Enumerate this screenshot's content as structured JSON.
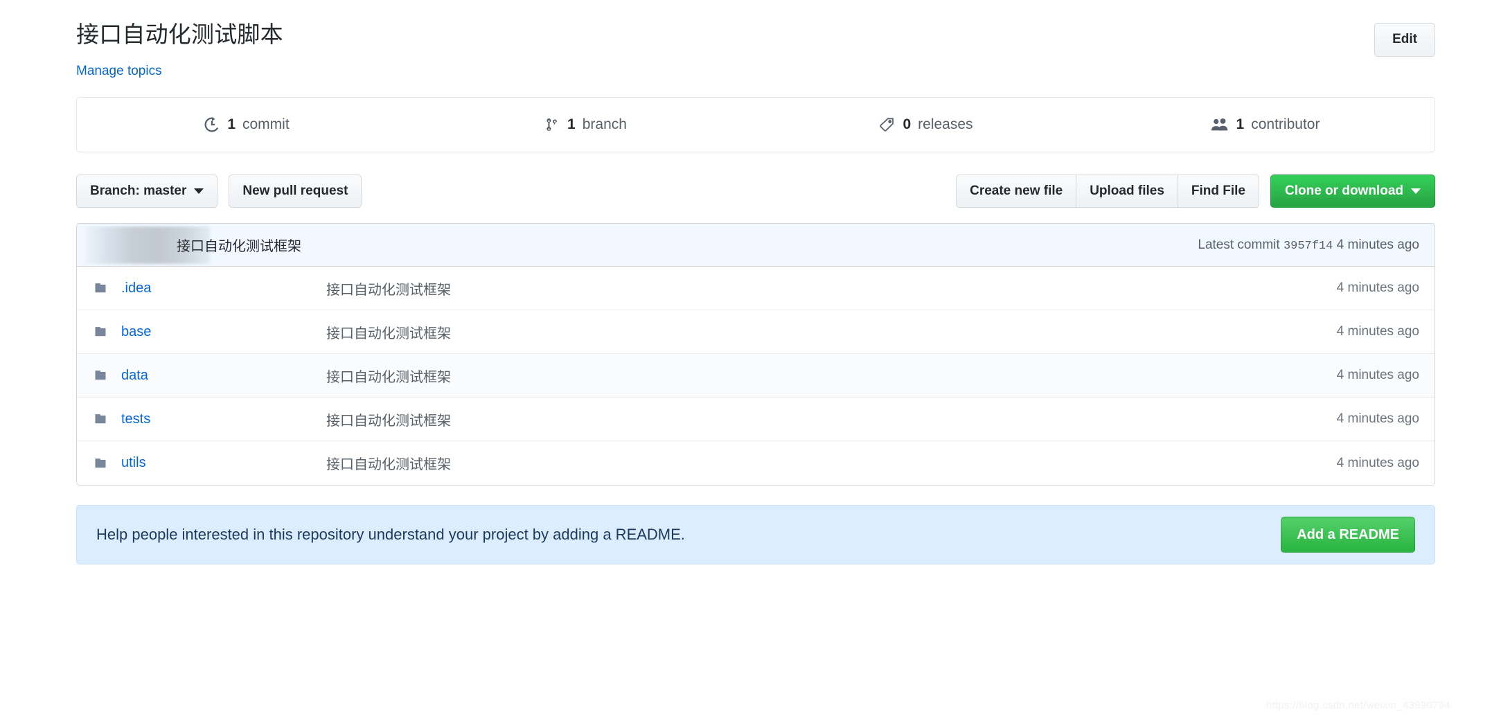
{
  "repo": {
    "title": "接口自动化测试脚本",
    "manage_topics_label": "Manage topics",
    "edit_button_label": "Edit"
  },
  "summary": {
    "items": [
      {
        "icon": "history-icon",
        "count": "1",
        "label": "commit",
        "name": "commits-summary"
      },
      {
        "icon": "git-branch-icon",
        "count": "1",
        "label": "branch",
        "name": "branches-summary"
      },
      {
        "icon": "tag-icon",
        "count": "0",
        "label": "releases",
        "name": "releases-summary"
      },
      {
        "icon": "people-icon",
        "count": "1",
        "label": "contributor",
        "name": "contributors-summary"
      }
    ]
  },
  "file_nav": {
    "branch_label": "Branch: master",
    "new_pull_request_label": "New pull request",
    "create_new_file_label": "Create new file",
    "upload_files_label": "Upload files",
    "find_file_label": "Find File",
    "clone_or_download_label": "Clone or download"
  },
  "commit_tease": {
    "author": "",
    "message": "接口自动化测试框架",
    "latest_commit_label": "Latest commit",
    "sha": "3957f14",
    "age": "4 minutes ago"
  },
  "files": {
    "columns": [
      "name",
      "message",
      "age"
    ],
    "rows": [
      {
        "type": "directory",
        "name": ".idea",
        "message": "接口自动化测试框架",
        "age": "4 minutes ago"
      },
      {
        "type": "directory",
        "name": "base",
        "message": "接口自动化测试框架",
        "age": "4 minutes ago"
      },
      {
        "type": "directory",
        "name": "data",
        "message": "接口自动化测试框架",
        "age": "4 minutes ago"
      },
      {
        "type": "directory",
        "name": "tests",
        "message": "接口自动化测试框架",
        "age": "4 minutes ago"
      },
      {
        "type": "directory",
        "name": "utils",
        "message": "接口自动化测试框架",
        "age": "4 minutes ago"
      }
    ]
  },
  "readme_callout": {
    "text": "Help people interested in this repository understand your project by adding a README.",
    "button_label": "Add a README"
  },
  "watermark": {
    "text": "https://blog.csdn.net/weixin_43890794"
  },
  "colors": {
    "link": "#0366d6",
    "green": "#28a745",
    "callout_bg": "#dbedff",
    "commit_tease_bg": "#f1f8ff",
    "folder_icon": "#79859b",
    "muted_text": "#586069"
  }
}
